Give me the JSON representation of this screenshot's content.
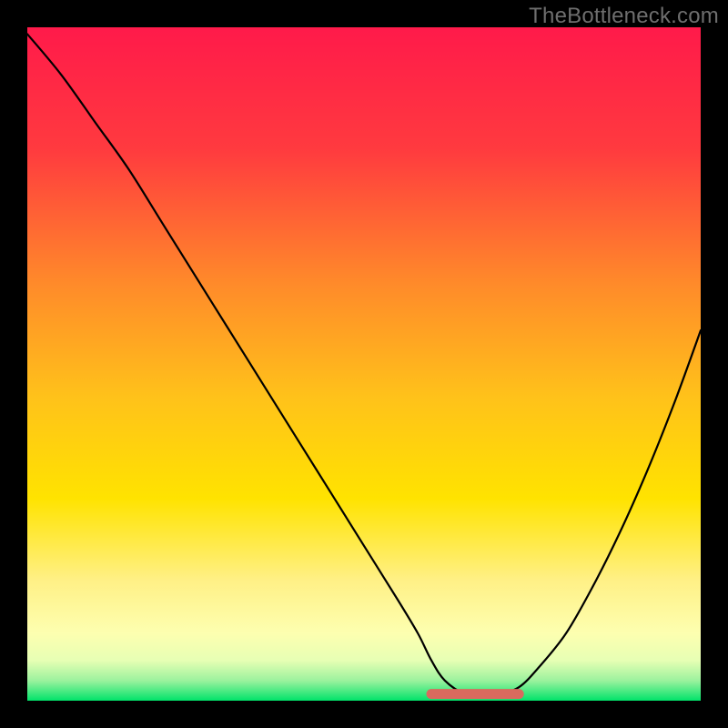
{
  "watermark": "TheBottleneck.com",
  "colors": {
    "frame": "#000000",
    "gradient_top": "#ff1a4a",
    "gradient_mid_upper": "#ff7a2e",
    "gradient_mid": "#ffd400",
    "gradient_lower_glow": "#ffff7a",
    "gradient_bottom": "#00e36a",
    "curve": "#000000",
    "optimal_marker": "#d96a5e"
  },
  "chart_data": {
    "type": "line",
    "title": "",
    "xlabel": "",
    "ylabel": "",
    "xlim": [
      0,
      100
    ],
    "ylim": [
      0,
      100
    ],
    "series": [
      {
        "name": "bottleneck-curve",
        "x": [
          0,
          5,
          10,
          15,
          20,
          25,
          30,
          35,
          40,
          45,
          50,
          55,
          58,
          60,
          62,
          65,
          68,
          70,
          73,
          76,
          80,
          84,
          88,
          92,
          96,
          100
        ],
        "values": [
          99,
          93,
          86,
          79,
          71,
          63,
          55,
          47,
          39,
          31,
          23,
          15,
          10,
          6,
          3,
          1,
          1,
          1,
          2,
          5,
          10,
          17,
          25,
          34,
          44,
          55
        ]
      }
    ],
    "optimal_range": {
      "x_start": 60,
      "x_end": 73,
      "y": 1
    },
    "annotations": []
  }
}
